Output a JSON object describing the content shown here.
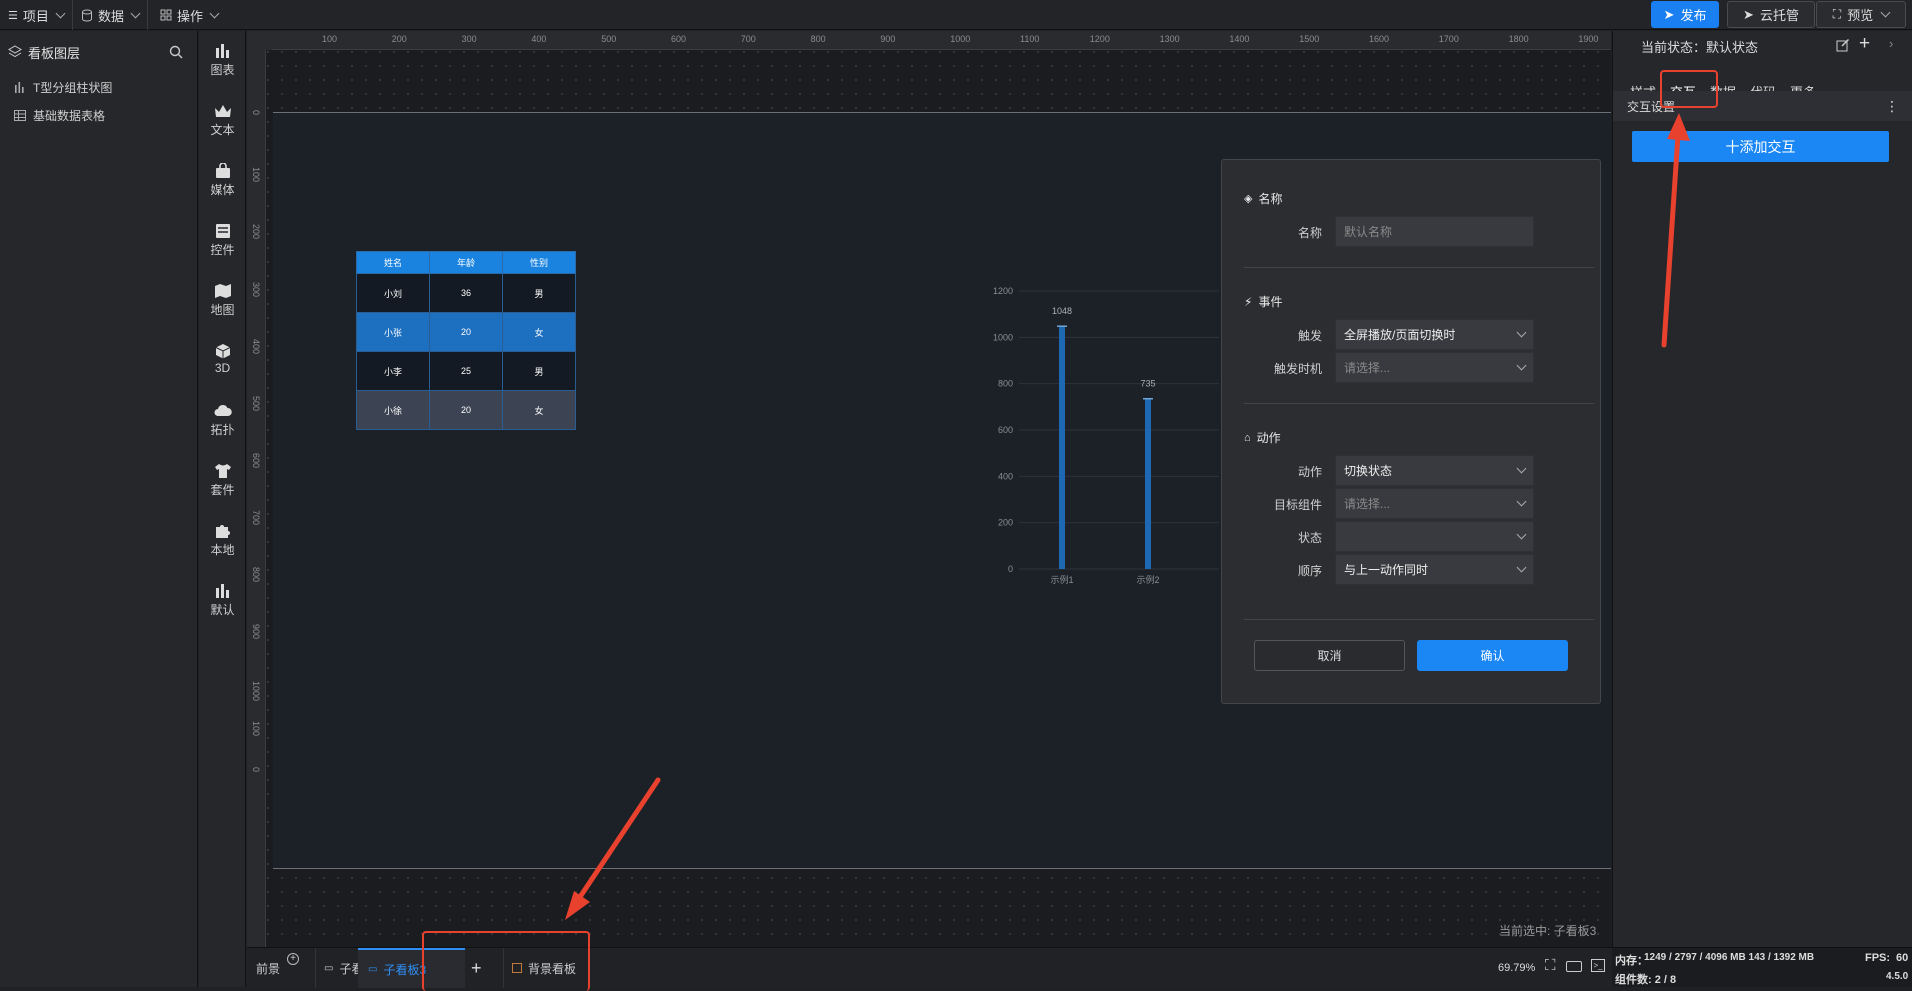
{
  "topbar": {
    "menus": [
      "项目",
      "数据",
      "操作"
    ],
    "publish": "发布",
    "cloud": "云托管",
    "preview": "预览"
  },
  "layers": {
    "title": "看板图层",
    "items": [
      "T型分组柱状图",
      "基础数据表格"
    ]
  },
  "components": [
    "图表",
    "文本",
    "媒体",
    "控件",
    "地图",
    "3D",
    "拓扑",
    "套件",
    "本地",
    "默认"
  ],
  "ruler": {
    "h": [
      "100",
      "200",
      "300",
      "400",
      "500",
      "600",
      "700",
      "800",
      "900",
      "1000",
      "1100",
      "1200",
      "1300",
      "1400",
      "1500",
      "1600",
      "1700",
      "1800",
      "1900"
    ],
    "v": [
      "0",
      "100",
      "200",
      "300",
      "400",
      "500",
      "600",
      "700",
      "800",
      "900",
      "1000",
      "100",
      "0"
    ]
  },
  "table": {
    "headers": [
      "姓名",
      "年龄",
      "性别"
    ],
    "rows": [
      [
        "小刘",
        "36",
        "男"
      ],
      [
        "小张",
        "20",
        "女"
      ],
      [
        "小李",
        "25",
        "男"
      ],
      [
        "小徐",
        "20",
        "女"
      ]
    ]
  },
  "chart_data": {
    "type": "bar",
    "categories": [
      "示例1",
      "示例2"
    ],
    "series": [
      {
        "values": [
          1048,
          735
        ]
      }
    ],
    "ylim": [
      0,
      1200
    ],
    "yticks": [
      "0",
      "200",
      "400",
      "600",
      "800",
      "1000",
      "1200"
    ],
    "labels": [
      "1048",
      "735"
    ],
    "grid": true,
    "color": "#1e67b2"
  },
  "dialog": {
    "sec_name": "名称",
    "name_label": "名称",
    "name_placeholder": "默认名称",
    "sec_event": "事件",
    "trigger_label": "触发",
    "trigger_value": "全屏播放/页面切换时",
    "timing_label": "触发时机",
    "timing_value": "请选择...",
    "sec_action": "动作",
    "action_label": "动作",
    "action_value": "切换状态",
    "target_label": "目标组件",
    "target_value": "请选择...",
    "state_label": "状态",
    "state_value": "",
    "order_label": "顺序",
    "order_value": "与上一动作同时",
    "cancel": "取消",
    "confirm": "确认"
  },
  "props": {
    "state": "当前状态：默认状态",
    "tabs": [
      "样式",
      "交互",
      "数据",
      "代码",
      "更多"
    ],
    "section": "交互设置",
    "add": "十添加交互"
  },
  "statusbar": {
    "front": "前景",
    "tab1": "子看板1",
    "tab3": "子看板3",
    "bg": "背景看板",
    "zoom": "69.79%",
    "selected": "当前选中: 子看板3"
  },
  "sysinfo": {
    "mem": "内存：",
    "mem_value": "1249 / 2797 / 4096 MB  143 / 1392 MB",
    "fps": "FPS:",
    "fps_value": "60",
    "count": "组件数: 2 / 8",
    "version": "4.5.0"
  }
}
